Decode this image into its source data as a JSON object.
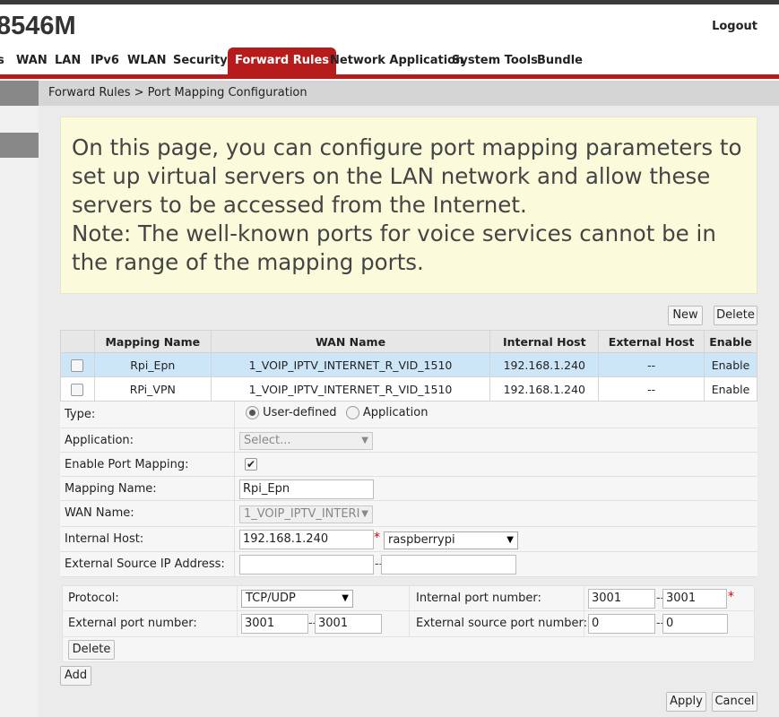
{
  "header": {
    "brand": "8546M",
    "logout": "Logout"
  },
  "nav": {
    "items": [
      "s",
      "WAN",
      "LAN",
      "IPv6",
      "WLAN",
      "Security",
      "Forward Rules",
      "Network Application",
      "System Tools",
      "Bundle"
    ],
    "active": "Forward Rules"
  },
  "breadcrumb": "Forward Rules > Port Mapping Configuration",
  "info": {
    "line1": "On this page, you can configure port mapping parameters to set up virtual servers on the LAN network and allow these servers to be accessed from the Internet.",
    "line2": "Note: The well-known ports for voice services cannot be in the range of the mapping ports."
  },
  "toolbar": {
    "new": "New",
    "delete": "Delete"
  },
  "table": {
    "headers": [
      "Mapping Name",
      "WAN Name",
      "Internal Host",
      "External Host",
      "Enable"
    ],
    "rows": [
      {
        "name": "Rpi_Epn",
        "wan": "1_VOIP_IPTV_INTERNET_R_VID_1510",
        "internal": "192.168.1.240",
        "external": "--",
        "enable": "Enable"
      },
      {
        "name": "RPi_VPN",
        "wan": "1_VOIP_IPTV_INTERNET_R_VID_1510",
        "internal": "192.168.1.240",
        "external": "--",
        "enable": "Enable"
      }
    ]
  },
  "form": {
    "type_label": "Type:",
    "type_user": "User-defined",
    "type_app": "Application",
    "application_label": "Application:",
    "application_value": "Select...",
    "enable_label": "Enable Port Mapping:",
    "mapping_name_label": "Mapping Name:",
    "mapping_name_value": "Rpi_Epn",
    "wan_name_label": "WAN Name:",
    "wan_name_value": "1_VOIP_IPTV_INTERI",
    "internal_host_label": "Internal Host:",
    "internal_host_value": "192.168.1.240",
    "internal_host_device": "raspberrypi",
    "ext_src_ip_label": "External Source IP Address:",
    "ext_src_ip_from": "",
    "ext_src_ip_to": ""
  },
  "ports": {
    "protocol_label": "Protocol:",
    "protocol_value": "TCP/UDP",
    "internal_port_label": "Internal port number:",
    "internal_from": "3001",
    "internal_to": "3001",
    "external_port_label": "External port number:",
    "external_from": "3001",
    "external_to": "3001",
    "ext_src_port_label": "External source port number:",
    "ext_src_from": "0",
    "ext_src_to": "0",
    "delete": "Delete"
  },
  "buttons": {
    "add": "Add",
    "apply": "Apply",
    "cancel": "Cancel"
  }
}
